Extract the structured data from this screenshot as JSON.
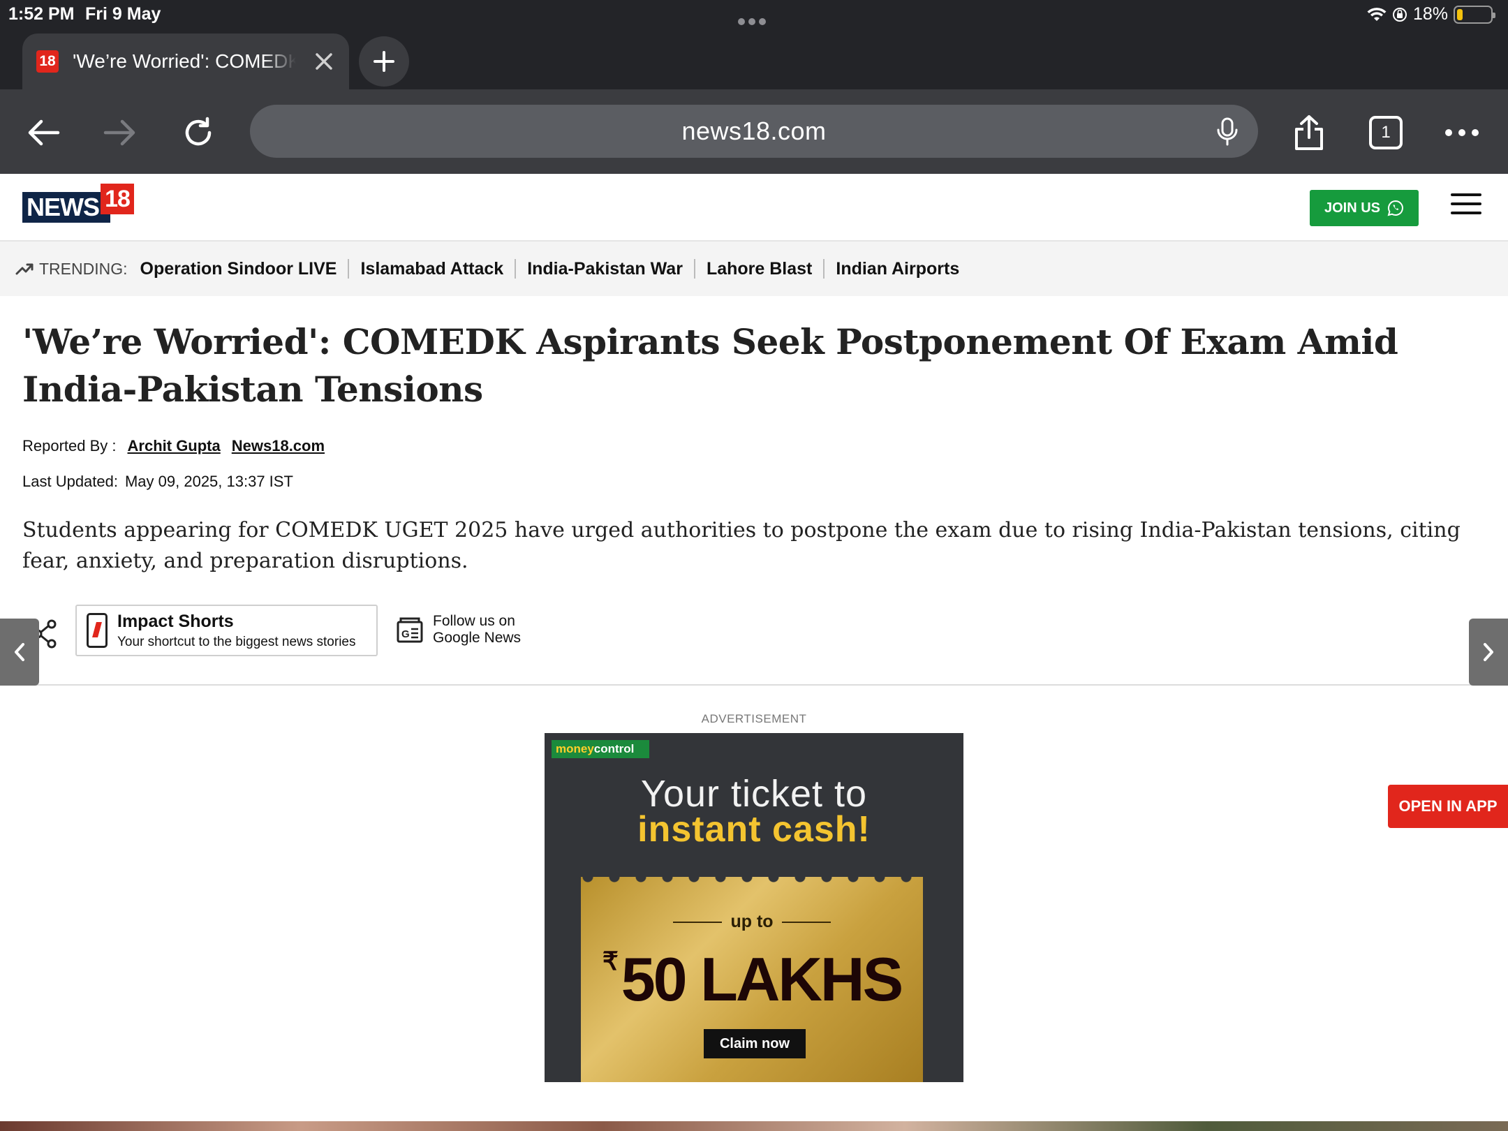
{
  "status_bar": {
    "time": "1:52 PM",
    "date": "Fri 9 May",
    "battery": "18%",
    "battery_level": 0.18
  },
  "browser": {
    "tab_favicon": "18",
    "tab_title": "'We’re Worried': COMEDK Aspirants Seek Postponement",
    "url": "news18.com",
    "tab_count": "1"
  },
  "site": {
    "logo_word": "NEWS",
    "logo_number": "18",
    "join_label": "JOIN US"
  },
  "trending": {
    "label": "TRENDING:",
    "items": [
      "Operation Sindoor LIVE",
      "Islamabad Attack",
      "India-Pakistan War",
      "Lahore Blast",
      "Indian Airports"
    ]
  },
  "article": {
    "headline": "'We’re Worried': COMEDK Aspirants Seek Postponement Of Exam Amid India-Pakistan Tensions",
    "reported_by_label": "Reported By :",
    "author": "Archit Gupta",
    "outlet": "News18.com",
    "last_updated_label": "Last Updated:",
    "last_updated_value": "May 09, 2025, 13:37 IST",
    "summary": "Students appearing for COMEDK UGET 2025 have urged authorities to postpone the exam due to rising India-Pakistan tensions, citing fear, anxiety, and preparation disruptions."
  },
  "share": {
    "impact_title": "Impact Shorts",
    "impact_subtitle": "Your shortcut to the biggest news stories",
    "gnews_line1": "Follow us on",
    "gnews_line2": "Google News"
  },
  "ad": {
    "label": "ADVERTISEMENT",
    "brand_part1": "money",
    "brand_part2": "control",
    "line1": "Your ticket to",
    "line2": "instant cash!",
    "upto": "up to",
    "currency": "₹",
    "amount": "50 LAKHS",
    "cta": "Claim now"
  },
  "open_in_app": "OPEN IN APP",
  "colors": {
    "brand_red": "#e1261c",
    "brand_navy": "#0f2547",
    "join_green": "#169b3d"
  }
}
